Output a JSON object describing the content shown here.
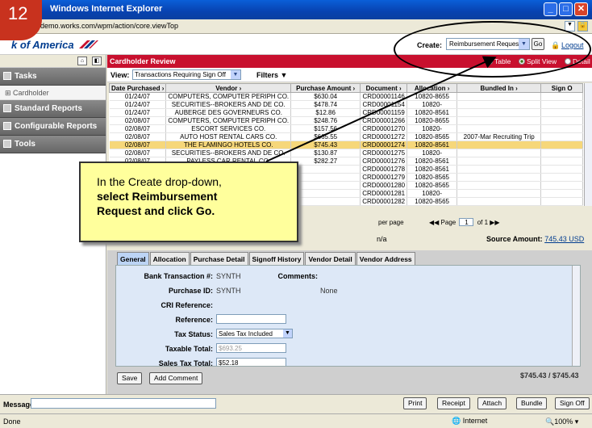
{
  "step_number": "12",
  "window": {
    "title": "Windows Internet Explorer",
    "url": "demo.works.com/wpm/action/core.viewTop"
  },
  "brand": {
    "logo_text": "k of America"
  },
  "create": {
    "label": "Create:",
    "selected": "Reimbursement Request",
    "go_label": "Go",
    "logout_label": "Logout"
  },
  "leftnav": {
    "tasks": "Tasks",
    "cardholder": "Cardholder",
    "standard_reports": "Standard Reports",
    "configurable_reports": "Configurable Reports",
    "tools": "Tools"
  },
  "header": {
    "title": "Cardholder Review",
    "options": [
      "Table",
      "Split View",
      "Detail"
    ]
  },
  "viewbar": {
    "label": "View:",
    "selected": "Transactions Requiring Sign Off",
    "filters": "Filters ▼"
  },
  "table": {
    "columns": [
      "Date Purchased ›",
      "Vendor ›",
      "Purchase Amount ›",
      "Document ›",
      "Allocation ›",
      "Bundled In ›",
      "Sign O"
    ],
    "rows": [
      [
        "01/24/07",
        "COMPUTERS, COMPUTER PERIPH CO.",
        "$630.04",
        "CRD00001146",
        "10820-8655",
        "",
        ""
      ],
      [
        "01/24/07",
        "SECURITIES--BROKERS AND DE CO.",
        "$478.74",
        "CRD00001154",
        "10820-",
        "",
        ""
      ],
      [
        "01/24/07",
        "AUBERGE DES GOVERNEURS CO.",
        "$12.86",
        "CRD00001159",
        "10820-8561",
        "",
        ""
      ],
      [
        "02/08/07",
        "COMPUTERS, COMPUTER PERIPH CO.",
        "$248.76",
        "CRD00001266",
        "10820-8655",
        "",
        ""
      ],
      [
        "02/08/07",
        "ESCORT SERVICES CO.",
        "$157.56",
        "CRD00001270",
        "10820-",
        "",
        ""
      ],
      [
        "02/08/07",
        "AUTO HOST RENTAL CARS CO.",
        "$665.55",
        "CRD00001272",
        "10820-8565",
        "2007-Mar Recruiting Trip",
        ""
      ],
      [
        "02/08/07",
        "THE FLAMINGO HOTELS CO.",
        "$745.43",
        "CRD00001274",
        "10820-8561",
        "",
        ""
      ],
      [
        "02/08/07",
        "SECURITIES--BROKERS AND DE CO.",
        "$130.87",
        "CRD00001275",
        "10820-",
        "",
        ""
      ],
      [
        "02/08/07",
        "PAYLESS CAR RENTAL CO.",
        "$282.27",
        "CRD00001276",
        "10820-8561",
        "",
        ""
      ],
      [
        "",
        "",
        "",
        "CRD00001278",
        "10820-8561",
        "",
        ""
      ],
      [
        "",
        "",
        "",
        "CRD00001279",
        "10820-8565",
        "",
        ""
      ],
      [
        "",
        "",
        "",
        "CRD00001280",
        "10820-8565",
        "",
        ""
      ],
      [
        "",
        "",
        "",
        "CRD00001281",
        "10820-",
        "",
        ""
      ],
      [
        "",
        "",
        "",
        "CRD00001282",
        "10820-8565",
        "",
        ""
      ],
      [
        "",
        "",
        "",
        "CRD00001283",
        "10820-8561",
        "",
        ""
      ]
    ],
    "highlighted_row": 6
  },
  "pager": {
    "per_page": "per page",
    "page_label": "Page",
    "page_value": "1",
    "of": "of 1",
    "first": "◀◀",
    "last": "▶▶"
  },
  "info": {
    "na": "n/a",
    "source_amount_label": "Source Amount:",
    "source_amount_value": "745.43 USD"
  },
  "detail_tabs": [
    "General",
    "Allocation",
    "Purchase Detail",
    "Signoff History",
    "Vendor Detail",
    "Vendor Address"
  ],
  "form": {
    "bank_txn_label": "Bank Transaction #:",
    "bank_txn_value": "SYNTH",
    "purchase_id_label": "Purchase ID:",
    "purchase_id_value": "SYNTH",
    "cri_label": "CRI Reference:",
    "reference_label": "Reference:",
    "tax_status_label": "Tax Status:",
    "tax_status_value": "Sales Tax Included",
    "taxable_total_label": "Taxable Total:",
    "taxable_total_value": "$693.25",
    "sales_tax_label": "Sales Tax Total:",
    "sales_tax_value": "$52.18",
    "comments_label": "Comments:",
    "comments_value": "None"
  },
  "actions": {
    "save": "Save",
    "add_comment": "Add Comment",
    "totals": "$745.43 / $745.43"
  },
  "message": {
    "label": "Message:"
  },
  "bottom_buttons": [
    "Print",
    "Receipt",
    "Attach",
    "Bundle",
    "Sign Off"
  ],
  "status": {
    "left": "Done",
    "zone": "Internet",
    "zoom": "100%"
  },
  "callout": {
    "line1": "In the Create drop-down,",
    "line2": "select Reimbursement",
    "line3": "Request and click Go."
  }
}
